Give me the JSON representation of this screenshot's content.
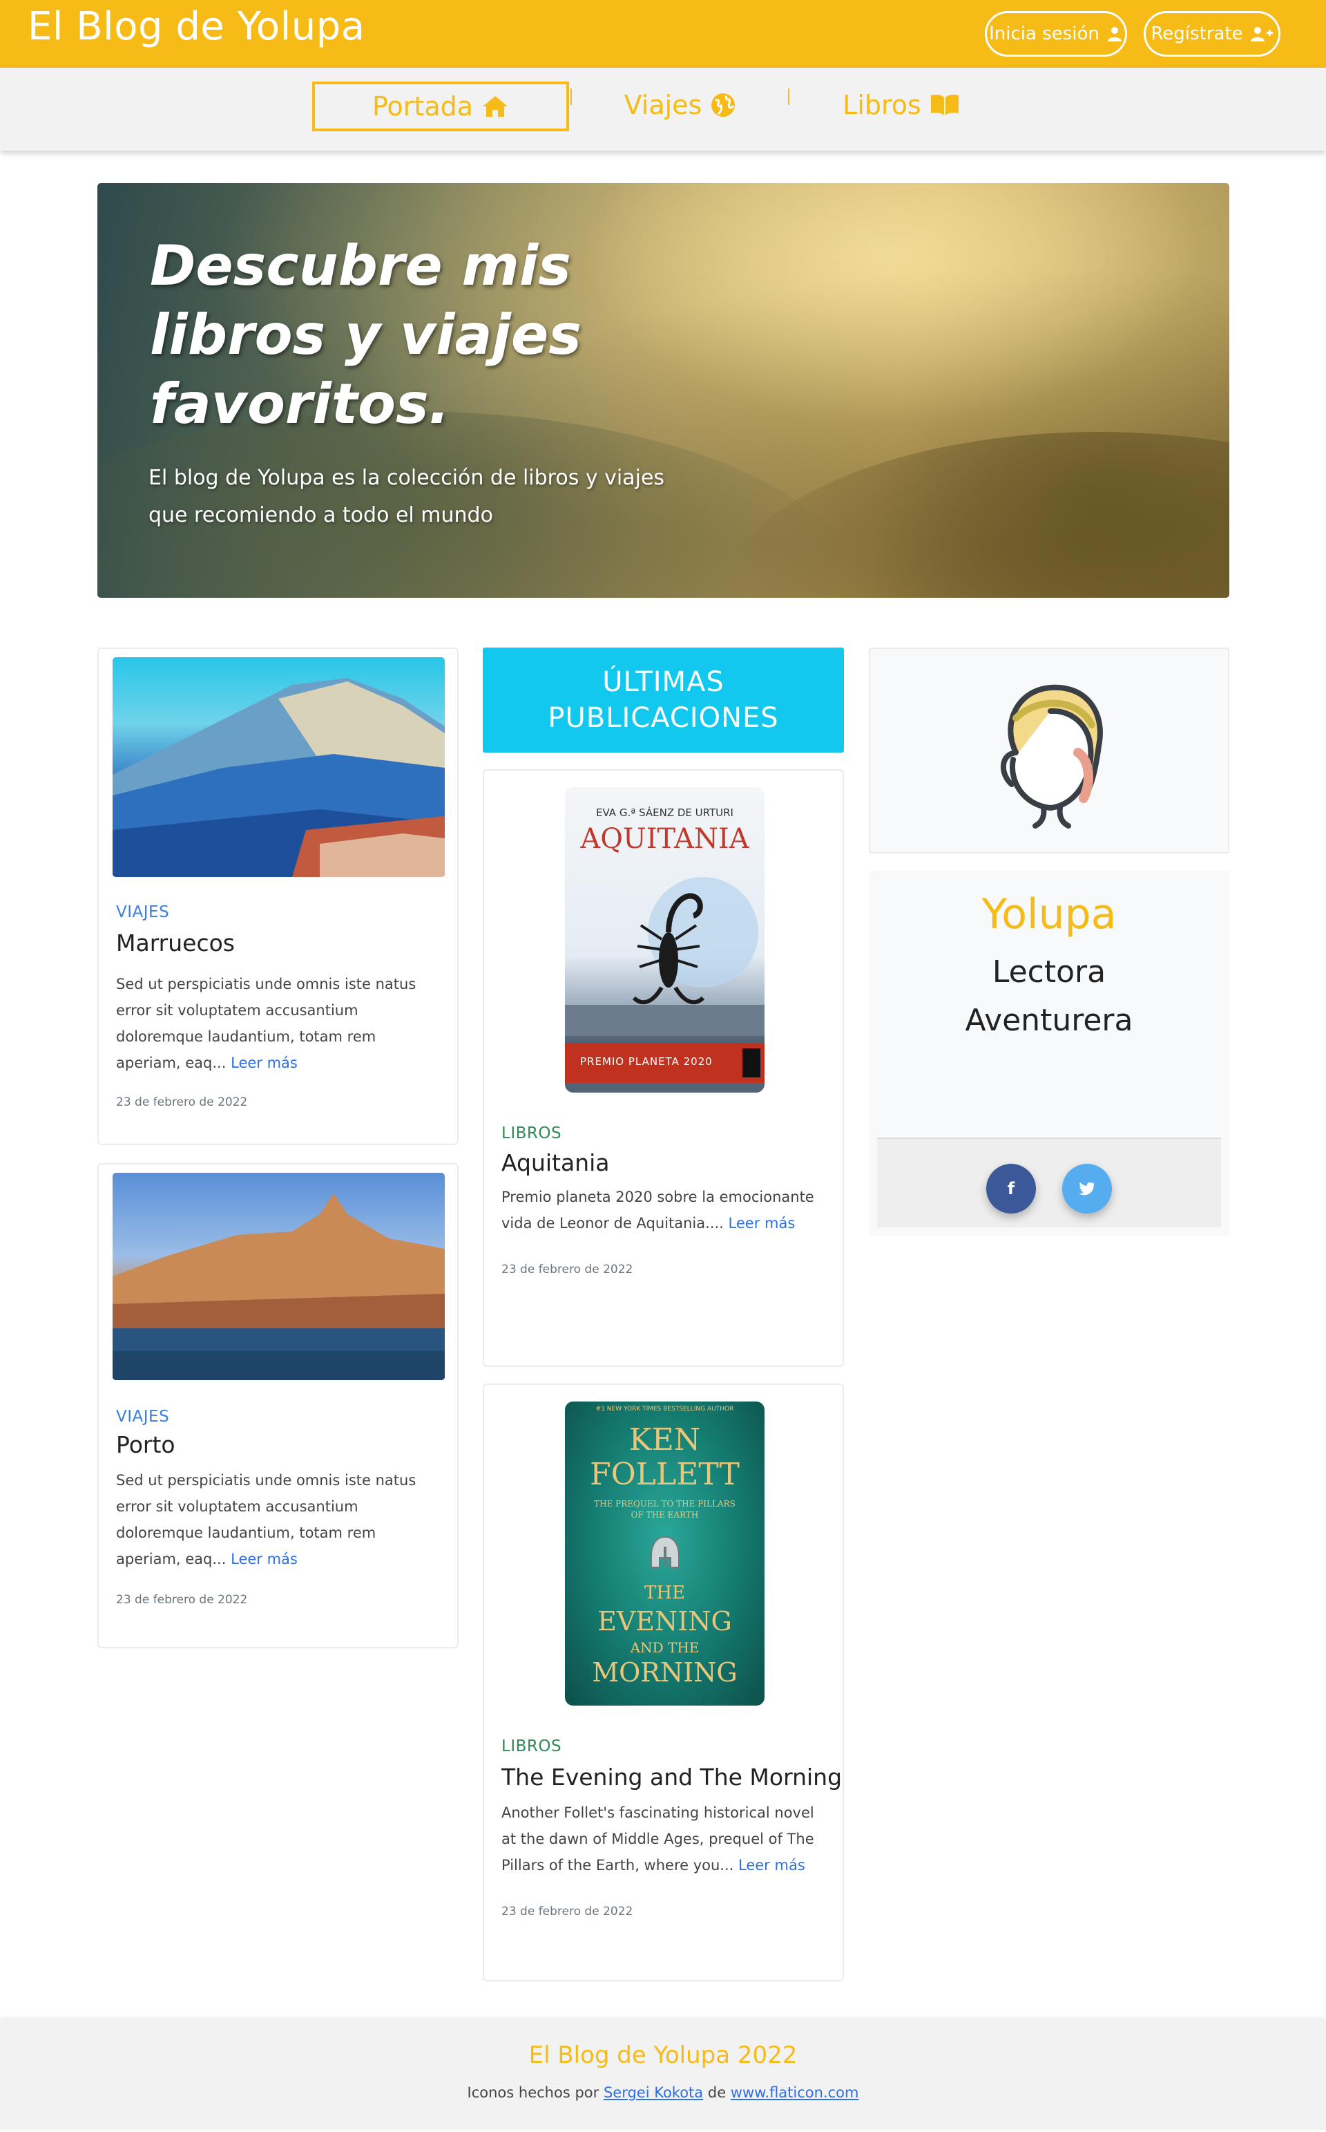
{
  "header": {
    "brand": "El Blog de Yolupa",
    "login_label": "Inicia sesión",
    "register_label": "Regístrate",
    "colors": {
      "brand_yellow": "#f6bb17",
      "accent_cyan": "#12c8ee",
      "link_blue": "#2f6fe0"
    }
  },
  "nav": {
    "items": [
      {
        "label": "Portada",
        "icon": "home-icon",
        "active": true
      },
      {
        "label": "Viajes",
        "icon": "globe-icon",
        "active": false
      },
      {
        "label": "Libros",
        "icon": "book-icon",
        "active": false
      }
    ]
  },
  "hero": {
    "title": "Descubre mis libros y viajes favoritos.",
    "subtitle": "El blog de Yolupa es la colección de libros y viajes que recomiendo a todo el mundo"
  },
  "travel_posts": [
    {
      "category": "VIAJES",
      "title": "Marruecos",
      "excerpt": "Sed ut perspiciatis unde omnis iste natus error sit voluptatem accusantium doloremque laudantium, totam rem aperiam, eaq...",
      "read_more": "Leer más",
      "date": "23 de febrero de 2022"
    },
    {
      "category": "VIAJES",
      "title": "Porto",
      "excerpt": "Sed ut perspiciatis unde omnis iste natus error sit voluptatem accusantium doloremque laudantium, totam rem aperiam, eaq...",
      "read_more": "Leer más",
      "date": "23 de febrero de 2022"
    }
  ],
  "latest": {
    "heading": "ÚLTIMAS PUBLICACIONES",
    "posts": [
      {
        "category": "LIBROS",
        "title": "Aquitania",
        "excerpt": "Premio planeta 2020 sobre la emocionante vida de Leonor de Aquitania....",
        "read_more": "Leer más",
        "date": "23 de febrero de 2022",
        "cover": {
          "author": "EVA G.ª SÁENZ DE URTURI",
          "title": "AQUITANIA",
          "band": "PREMIO PLANETA 2020"
        }
      },
      {
        "category": "LIBROS",
        "title": "The Evening and The Morning",
        "excerpt": "Another Follet's fascinating historical novel at the dawn of Middle Ages, prequel of The Pillars of the Earth, where you...",
        "read_more": "Leer más",
        "date": "23 de febrero de 2022",
        "cover": {
          "tagline": "#1 NEW YORK TIMES BESTSELLING AUTHOR",
          "author_line1": "KEN",
          "author_line2": "FOLLETT",
          "prequel": "THE PREQUEL TO THE PILLARS OF THE EARTH",
          "title_line1": "THE",
          "title_line2": "EVENING",
          "title_line3": "AND THE",
          "title_line4": "MORNING"
        }
      }
    ]
  },
  "profile": {
    "name": "Yolupa",
    "role": "Lectora Aventurera",
    "social": [
      {
        "network": "facebook",
        "icon": "facebook-icon",
        "glyph": "f"
      },
      {
        "network": "twitter",
        "icon": "twitter-icon",
        "glyph": "t"
      }
    ]
  },
  "footer": {
    "title": "El Blog de Yolupa 2022",
    "credit_prefix": "Iconos hechos por",
    "credit_author": "Sergei Kokota",
    "credit_middle": "de",
    "credit_site": "www.flaticon.com"
  }
}
